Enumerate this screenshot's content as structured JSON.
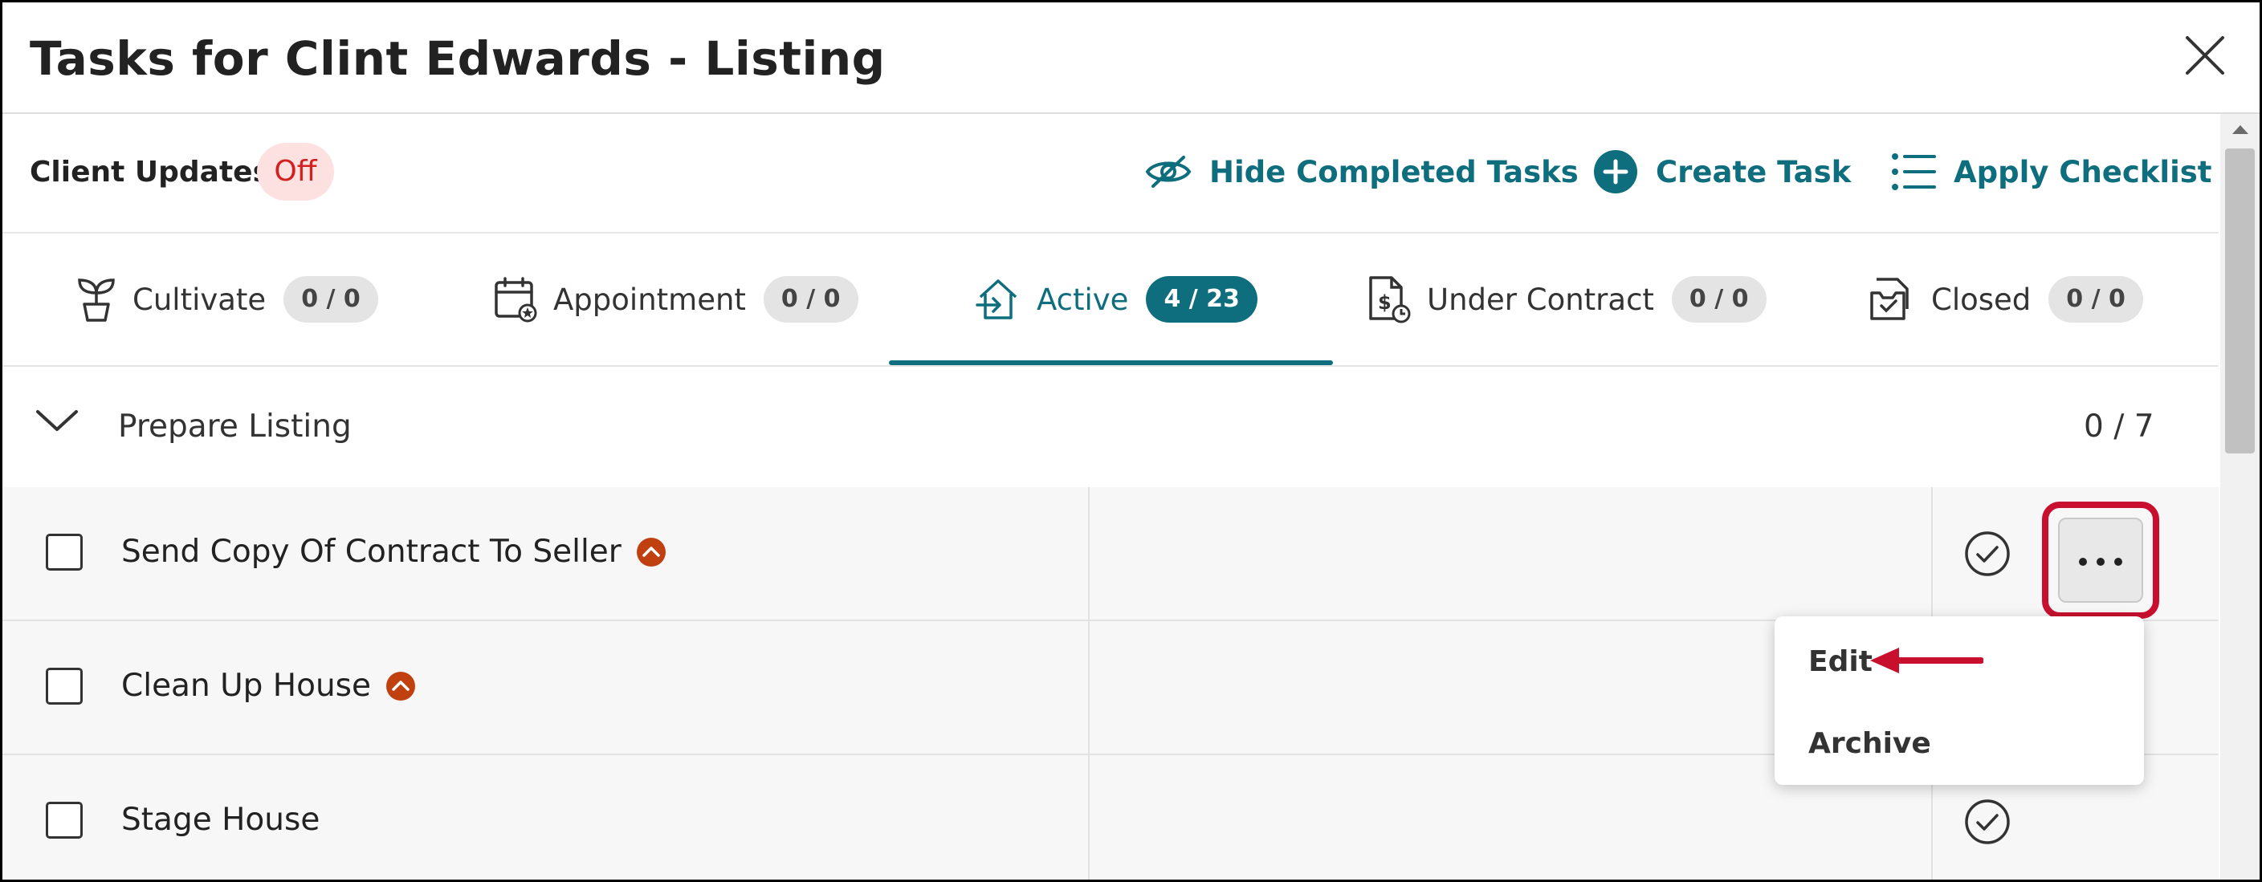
{
  "window": {
    "title": "Tasks for Clint Edwards - Listing"
  },
  "toolbar": {
    "client_updates_label": "Client Updates:",
    "client_updates_value": "Off",
    "hide_completed_label": "Hide Completed Tasks",
    "create_task_label": "Create Task",
    "apply_checklist_label": "Apply Checklist"
  },
  "tabs": [
    {
      "label": "Cultivate",
      "count": "0 / 0",
      "icon": "plant-icon"
    },
    {
      "label": "Appointment",
      "count": "0 / 0",
      "icon": "calendar-star-icon"
    },
    {
      "label": "Active",
      "count": "4 / 23",
      "icon": "house-arrow-icon",
      "active": true
    },
    {
      "label": "Under Contract",
      "count": "0 / 0",
      "icon": "document-dollar-icon"
    },
    {
      "label": "Closed",
      "count": "0 / 0",
      "icon": "document-check-icon"
    }
  ],
  "group": {
    "title": "Prepare Listing",
    "count": "0 / 7"
  },
  "tasks": [
    {
      "name": "Send Copy Of Contract To Seller",
      "priority": true
    },
    {
      "name": "Clean Up House",
      "priority": true
    },
    {
      "name": "Stage House",
      "priority": false
    }
  ],
  "menu": {
    "edit_label": "Edit",
    "archive_label": "Archive"
  },
  "colors": {
    "accent": "#0f6e7e",
    "highlight": "#c8102e",
    "priority": "#c0410f",
    "off_text": "#d21f1f",
    "off_bg": "#fde1e1"
  }
}
